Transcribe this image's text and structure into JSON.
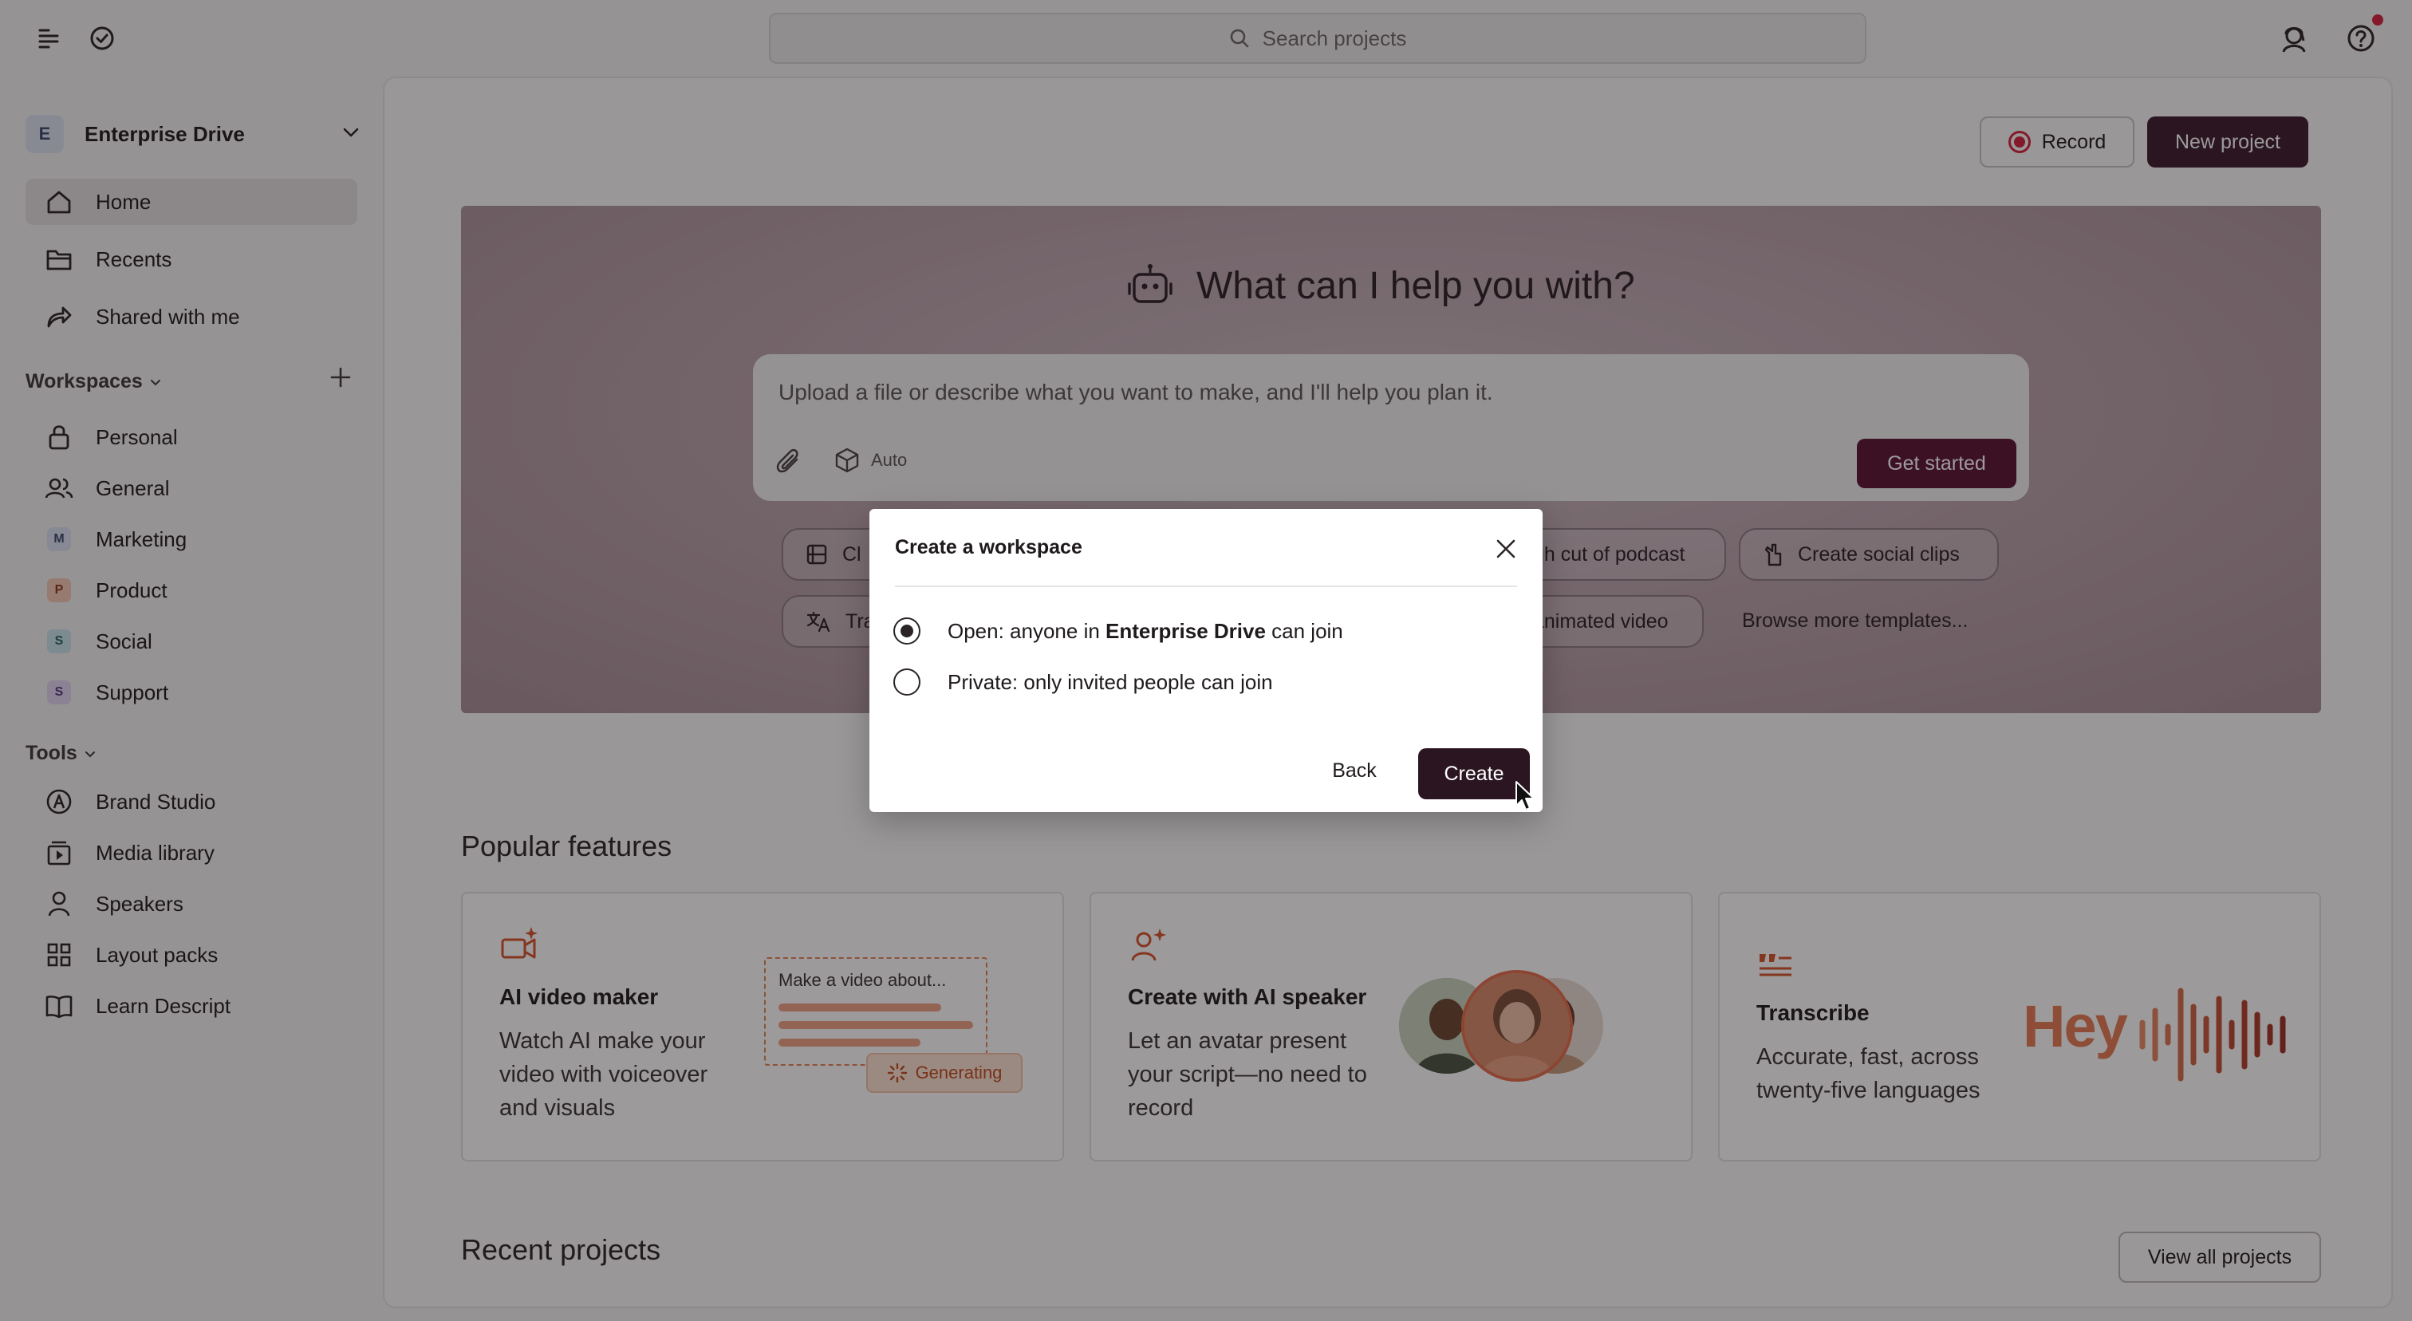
{
  "topbar": {
    "search_placeholder": "Search projects",
    "icons": [
      "sidebar-toggle-icon",
      "checkmark-circle-icon",
      "profile-avatar-icon",
      "help-icon"
    ]
  },
  "sidebar": {
    "workspace_switcher": {
      "initial": "E",
      "name": "Enterprise Drive"
    },
    "nav": [
      {
        "label": "Home",
        "icon": "home-icon",
        "active": true
      },
      {
        "label": "Recents",
        "icon": "folder-icon"
      },
      {
        "label": "Shared with me",
        "icon": "share-icon"
      }
    ],
    "workspaces_heading": "Workspaces",
    "workspaces": [
      {
        "label": "Personal",
        "icon": "lock-icon"
      },
      {
        "label": "General",
        "icon": "people-icon"
      },
      {
        "label": "Marketing",
        "letter": "M",
        "color": "#dbe3f3"
      },
      {
        "label": "Product",
        "letter": "P",
        "color": "#f6c9b5"
      },
      {
        "label": "Social",
        "letter": "S",
        "color": "#c9e6ec"
      },
      {
        "label": "Support",
        "letter": "S",
        "color": "#e2d6f3"
      }
    ],
    "tools_heading": "Tools",
    "tools": [
      {
        "label": "Brand Studio",
        "icon": "brand-icon"
      },
      {
        "label": "Media library",
        "icon": "media-library-icon"
      },
      {
        "label": "Speakers",
        "icon": "person-icon"
      },
      {
        "label": "Layout packs",
        "icon": "grid-icon"
      },
      {
        "label": "Learn Descript",
        "icon": "book-icon"
      }
    ]
  },
  "header": {
    "record_label": "Record",
    "new_project_label": "New project"
  },
  "hero": {
    "title": "What can I help you with?",
    "prompt_placeholder": "Upload a file or describe what you want to make, and I'll help you plan it.",
    "model_label": "Auto",
    "get_started_label": "Get started",
    "chips": [
      "Cl",
      "gh cut of podcast",
      "Create social clips",
      "Tra",
      "animated video"
    ],
    "browse_label": "Browse more templates..."
  },
  "popular": {
    "heading": "Popular features",
    "cards": [
      {
        "title": "AI video maker",
        "desc": "Watch AI make your video with voiceover and visuals",
        "mock_text": "Make a video about...",
        "chip_label": "Generating"
      },
      {
        "title": "Create with AI speaker",
        "desc": "Let an avatar present your script—no need to record"
      },
      {
        "title": "Transcribe",
        "desc": "Accurate, fast, across twenty-five languages",
        "art_text": "Hey"
      }
    ]
  },
  "recent": {
    "heading": "Recent projects",
    "view_all_label": "View all projects"
  },
  "modal": {
    "title": "Create a workspace",
    "options": [
      {
        "prefix": "Open: anyone in ",
        "bold": "Enterprise Drive",
        "suffix": " can join",
        "selected": true
      },
      {
        "text": "Private: only invited people can join",
        "selected": false
      }
    ],
    "back_label": "Back",
    "create_label": "Create"
  },
  "colors": {
    "brand": "#3b1a2b",
    "get_started": "#5b1433",
    "accent_orange": "#e77a52",
    "record_red": "#d6243b"
  }
}
